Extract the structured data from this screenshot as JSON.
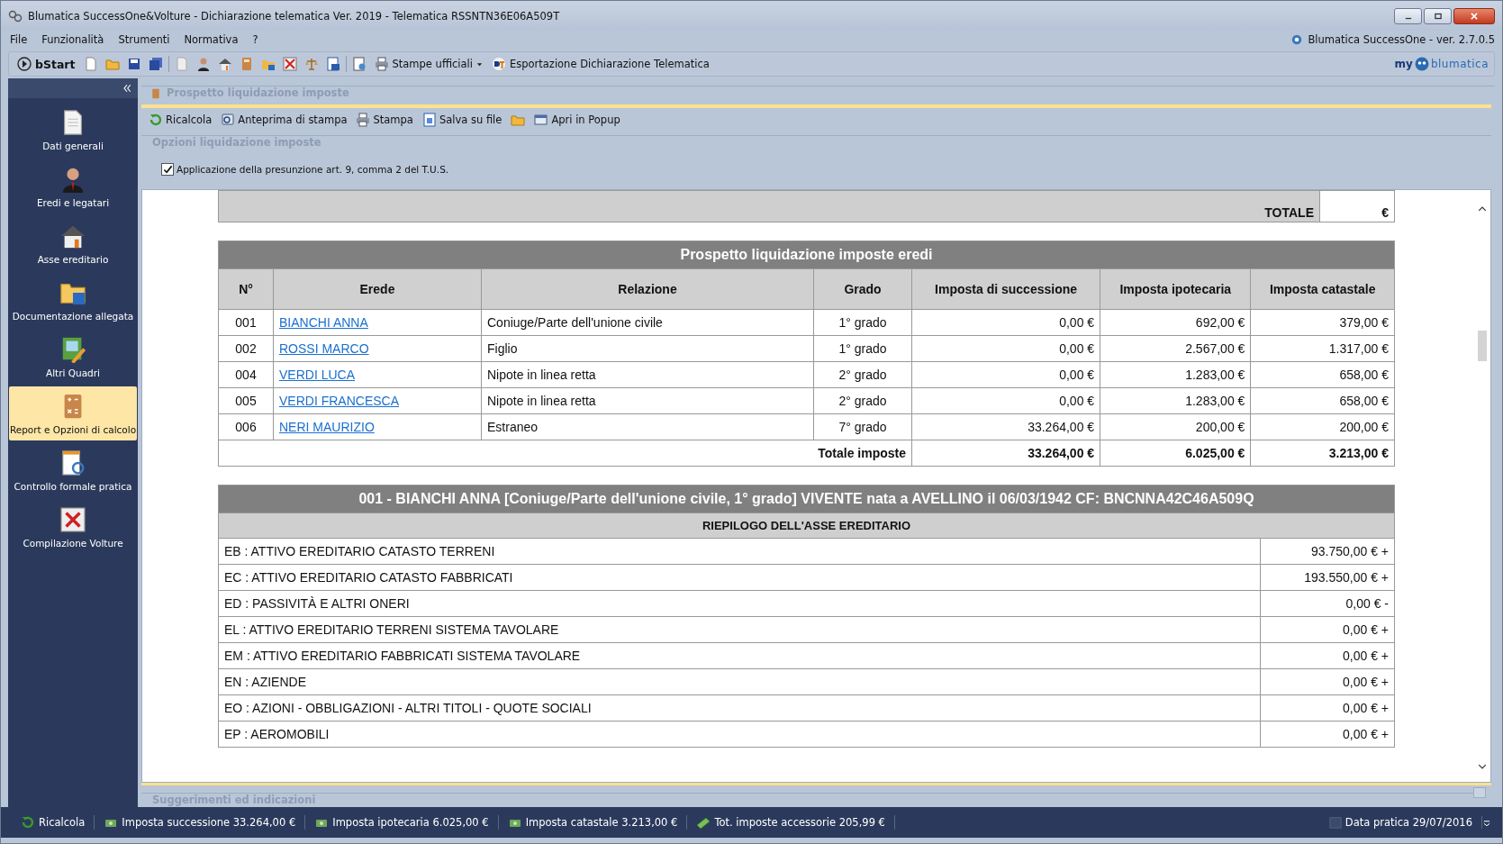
{
  "window": {
    "title": "Blumatica SuccessOne&Volture - Dichiarazione telematica Ver. 2019 - Telematica RSSNTN36E06A509T"
  },
  "menu": [
    "File",
    "Funzionalità",
    "Strumenti",
    "Normativa",
    "?"
  ],
  "version": "Blumatica SuccessOne - ver. 2.7.0.5",
  "toolbar": {
    "start": "bStart",
    "print_menu": "Stampe ufficiali",
    "export": "Esportazione Dichiarazione Telematica",
    "brand": {
      "prefix": "my",
      "name": "blumatica"
    }
  },
  "sidebar": {
    "items": [
      {
        "label": "Dati generali",
        "selected": false
      },
      {
        "label": "Eredi e legatari",
        "selected": false
      },
      {
        "label": "Asse ereditario",
        "selected": false
      },
      {
        "label": "Documentazione allegata",
        "selected": false
      },
      {
        "label": "Altri Quadri",
        "selected": false
      },
      {
        "label": "Report e Opzioni di calcolo",
        "selected": true
      },
      {
        "label": "Controllo formale pratica",
        "selected": false
      },
      {
        "label": "Compilazione Volture",
        "selected": false
      }
    ]
  },
  "panel": {
    "title": "Prospetto liquidazione imposte",
    "actions": [
      "Ricalcola",
      "Anteprima di stampa",
      "Stampa",
      "Salva su file",
      "Apri in Popup"
    ],
    "options_title": "Opzioni liquidazione imposte",
    "options": [
      {
        "label": "Applicazione della presunzione art. 9, comma 2 del T.U.S.",
        "checked": true
      }
    ]
  },
  "report": {
    "totale": {
      "label": "TOTALE",
      "value": "€"
    },
    "heirs_table": {
      "title": "Prospetto liquidazione imposte eredi",
      "columns": [
        "N°",
        "Erede",
        "Relazione",
        "Grado",
        "Imposta di successione",
        "Imposta ipotecaria",
        "Imposta catastale"
      ],
      "rows": [
        {
          "n": "001",
          "erede": "BIANCHI ANNA",
          "relazione": "Coniuge/Parte dell'unione civile",
          "grado": "1° grado",
          "successione": "0,00 €",
          "ipotecaria": "692,00 €",
          "catastale": "379,00 €"
        },
        {
          "n": "002",
          "erede": "ROSSI MARCO",
          "relazione": "Figlio",
          "grado": "1° grado",
          "successione": "0,00 €",
          "ipotecaria": "2.567,00 €",
          "catastale": "1.317,00 €"
        },
        {
          "n": "004",
          "erede": "VERDI LUCA",
          "relazione": "Nipote in linea retta",
          "grado": "2° grado",
          "successione": "0,00 €",
          "ipotecaria": "1.283,00 €",
          "catastale": "658,00 €"
        },
        {
          "n": "005",
          "erede": "VERDI FRANCESCA",
          "relazione": "Nipote in linea retta",
          "grado": "2° grado",
          "successione": "0,00 €",
          "ipotecaria": "1.283,00 €",
          "catastale": "658,00 €"
        },
        {
          "n": "006",
          "erede": "NERI MAURIZIO",
          "relazione": "Estraneo",
          "grado": "7° grado",
          "successione": "33.264,00 €",
          "ipotecaria": "200,00 €",
          "catastale": "200,00 €"
        }
      ],
      "totals": {
        "label": "Totale imposte",
        "values": [
          "33.264,00 €",
          "6.025,00 €",
          "3.213,00 €"
        ]
      }
    },
    "heir_section": {
      "title": "001 - BIANCHI ANNA [Coniuge/Parte dell'unione civile, 1° grado] VIVENTE nata a AVELLINO il 06/03/1942 CF: BNCNNA42C46A509Q",
      "summary_title": "RIEPILOGO DELL'ASSE EREDITARIO",
      "rows": [
        {
          "label": "EB : ATTIVO EREDITARIO CATASTO TERRENI",
          "value": "93.750,00 € +"
        },
        {
          "label": "EC : ATTIVO EREDITARIO CATASTO FABBRICATI",
          "value": "193.550,00 € +"
        },
        {
          "label": "ED : PASSIVITÀ E ALTRI ONERI",
          "value": "0,00 € -"
        },
        {
          "label": "EL : ATTIVO EREDITARIO TERRENI SISTEMA TAVOLARE",
          "value": "0,00 € +"
        },
        {
          "label": "EM : ATTIVO EREDITARIO FABBRICATI SISTEMA TAVOLARE",
          "value": "0,00 € +"
        },
        {
          "label": "EN : AZIENDE",
          "value": "0,00 € +"
        },
        {
          "label": "EO : AZIONI - OBBLIGAZIONI - ALTRI TITOLI - QUOTE SOCIALI",
          "value": "0,00 € +"
        },
        {
          "label": "EP : AEROMOBILI",
          "value": "0,00 € +"
        }
      ]
    }
  },
  "hints_title": "Suggerimenti ed indicazioni",
  "status_bar": {
    "items": [
      "Ricalcola",
      "Imposta successione 33.264,00 €",
      "Imposta ipotecaria 6.025,00 €",
      "Imposta catastale 3.213,00 €",
      "Tot. imposte accessorie 205,99 €"
    ],
    "date": "Data pratica 29/07/2016"
  }
}
